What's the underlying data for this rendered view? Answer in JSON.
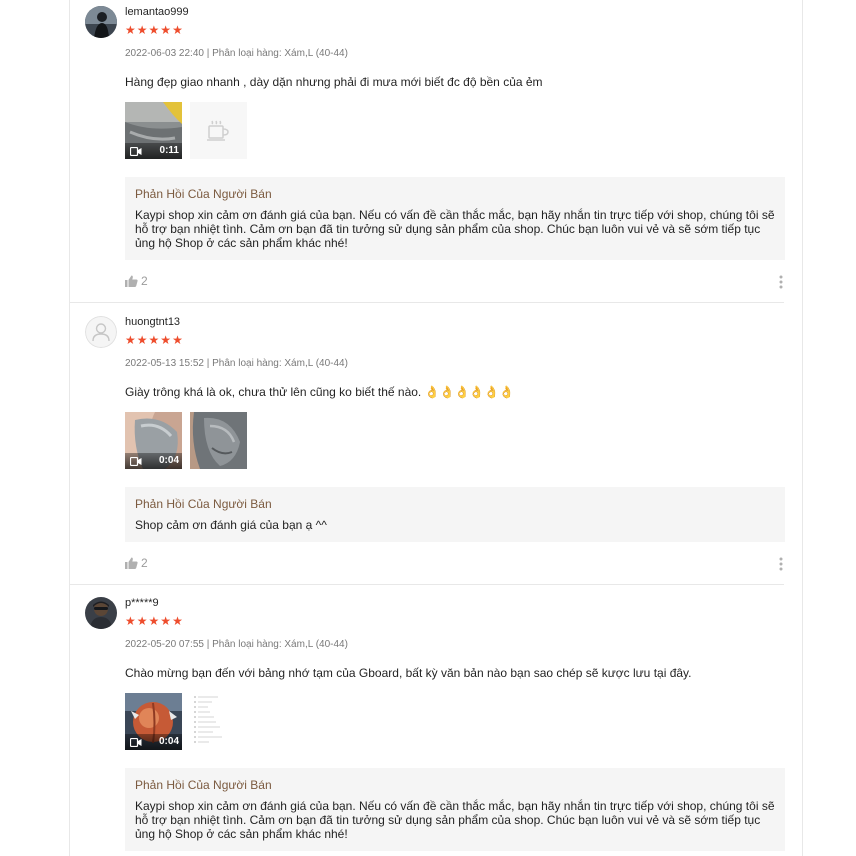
{
  "reviews": [
    {
      "username": "lemantao999",
      "rating": 5,
      "meta": "2022-06-03 22:40 | Phân loại hàng: Xám,L (40-44)",
      "comment": "Hàng đẹp giao nhanh , dày dặn nhưng phải đi mưa mới biết đc độ bền của ẻm",
      "media": [
        {
          "type": "video",
          "duration": "0:11"
        },
        {
          "type": "placeholder-image"
        }
      ],
      "reply_title": "Phản Hồi Của Người Bán",
      "reply_text": "Kaypi shop xin cảm ơn đánh giá của bạn. Nếu có vấn đề cần thắc mắc, bạn hãy nhắn tin trực tiếp với shop, chúng tôi sẽ hỗ trợ bạn nhiệt tình. Cảm ơn bạn đã tin tưởng sử dụng sản phẩm của shop. Chúc bạn luôn vui vẻ và sẽ sớm tiếp tục ủng hộ Shop ở các sản phẩm khác nhé!",
      "likes": "2"
    },
    {
      "username": "huongtnt13",
      "rating": 5,
      "meta": "2022-05-13 15:52 | Phân loại hàng: Xám,L (40-44)",
      "comment": "Giày trông khá là ok, chưa thử lên cũng ko biết thế nào. 👌👌👌👌👌👌",
      "media": [
        {
          "type": "video",
          "duration": "0:04"
        },
        {
          "type": "image"
        }
      ],
      "reply_title": "Phản Hồi Của Người Bán",
      "reply_text": "Shop cảm ơn đánh giá của bạn ạ ^^",
      "likes": "2"
    },
    {
      "username": "p*****9",
      "rating": 5,
      "meta": "2022-05-20 07:55 | Phân loại hàng: Xám,L (40-44)",
      "comment": "Chào mừng bạn đến với bảng nhớ tạm của Gboard, bất kỳ văn bản nào bạn sao chép sẽ kược lưu tại đây.",
      "media": [
        {
          "type": "video",
          "duration": "0:04"
        },
        {
          "type": "image"
        }
      ],
      "reply_title": "Phản Hồi Của Người Bán",
      "reply_text": "Kaypi shop xin cảm ơn đánh giá của bạn. Nếu có vấn đề cần thắc mắc, bạn hãy nhắn tin trực tiếp với shop, chúng tôi sẽ hỗ trợ bạn nhiệt tình. Cảm ơn bạn đã tin tưởng sử dụng sản phẩm của shop. Chúc bạn luôn vui vẻ và sẽ sớm tiếp tục ủng hộ Shop ở các sản phẩm khác nhé!"
    }
  ],
  "colors": {
    "star": "#ee4d2d",
    "reply_title": "#7b5a3f",
    "reply_bg": "#f5f5f5"
  },
  "icons": {
    "star": "star-icon",
    "like": "thumbs-up-icon",
    "more": "more-vertical-icon",
    "video": "video-camera-icon"
  }
}
